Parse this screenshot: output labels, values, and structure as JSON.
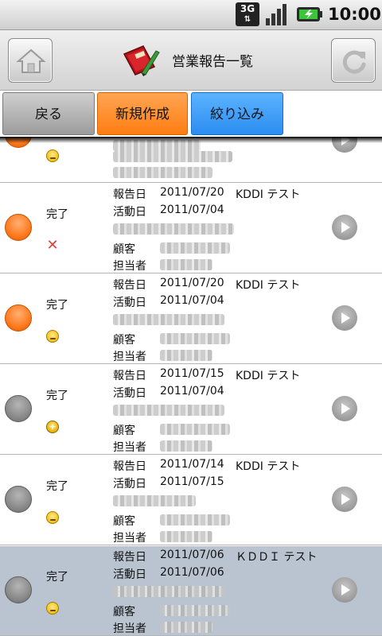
{
  "status_bar": {
    "network_label": "3G",
    "time": "10:00",
    "icons": [
      "3g-icon",
      "signal-icon",
      "battery-icon"
    ]
  },
  "title_bar": {
    "title": "営業報告一覧",
    "home_icon": "home-icon",
    "refresh_icon": "refresh-icon",
    "app_icon": "notebook-pen-icon"
  },
  "toolbar": {
    "back_label": "戻る",
    "new_label": "新規作成",
    "filter_label": "絞り込み"
  },
  "labels": {
    "report_date": "報告日",
    "activity_date": "活動日",
    "customer": "顧客",
    "person": "担当者"
  },
  "colors": {
    "new_button": "#ff8a24",
    "filter_button": "#3a9af5",
    "selected_row": "#b9c4d0",
    "status_orange": "#ff7a1f",
    "status_gray": "#8a8a8a"
  },
  "reports": [
    {
      "status": "完了",
      "status_color": "orange",
      "mark": "x-icon",
      "report_date": "2011/07/20",
      "activity_date": "2011/07/04",
      "company": "KDDI テスト",
      "selected": false
    },
    {
      "status": "完了",
      "status_color": "orange",
      "mark": "smiley-icon",
      "report_date": "2011/07/20",
      "activity_date": "2011/07/04",
      "company": "KDDI テスト",
      "selected": false
    },
    {
      "status": "完了",
      "status_color": "gray",
      "mark": "cross-smiley-icon",
      "report_date": "2011/07/15",
      "activity_date": "2011/07/04",
      "company": "KDDI テスト",
      "selected": false
    },
    {
      "status": "完了",
      "status_color": "gray",
      "mark": "smiley-icon",
      "report_date": "2011/07/14",
      "activity_date": "2011/07/15",
      "company": "KDDI テスト",
      "selected": false
    },
    {
      "status": "完了",
      "status_color": "gray",
      "mark": "smiley-icon",
      "report_date": "2011/07/06",
      "activity_date": "2011/07/06",
      "company": "ＫＤＤＩ テスト",
      "selected": true
    }
  ]
}
